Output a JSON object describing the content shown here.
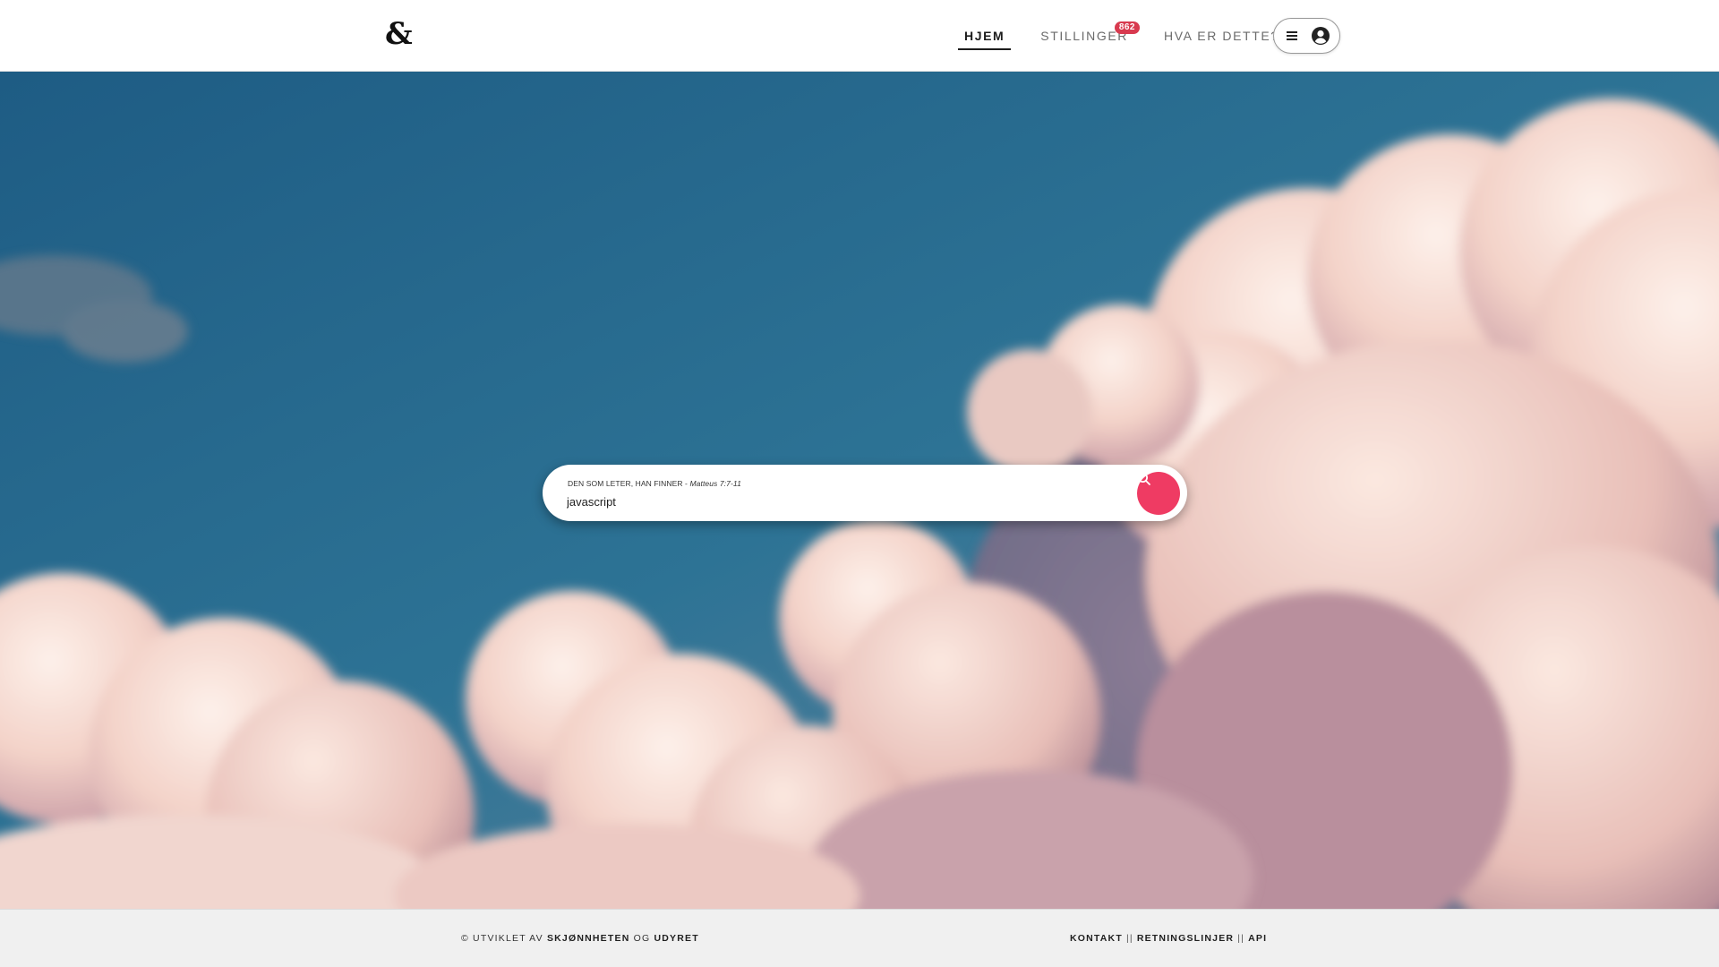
{
  "header": {
    "logo": "&",
    "nav": {
      "home": "HJEM",
      "jobs": "STILLINGER",
      "jobs_badge": "862",
      "about": "HVA ER DETTE?"
    }
  },
  "search": {
    "hint": "DEN SOM LETER, HAN FINNER -",
    "hint_ref": "Matteus 7:7-11",
    "value": "javascript"
  },
  "footer": {
    "copyright_prefix": "© UTVIKLET AV",
    "author_a": "SKJØNNHETEN",
    "connector": "OG",
    "author_b": "UDYRET",
    "links": {
      "contact": "KONTAKT",
      "guidelines": "RETNINGSLINJER",
      "api": "API",
      "separator": "||"
    }
  },
  "colors": {
    "accent": "#ef3b63",
    "badge": "#d83a4f",
    "sky": "#2b6f95",
    "cloud": "#f6d9d2"
  },
  "icons": {
    "menu": "hamburger-menu-icon",
    "avatar": "user-avatar-icon",
    "search": "search-icon"
  }
}
